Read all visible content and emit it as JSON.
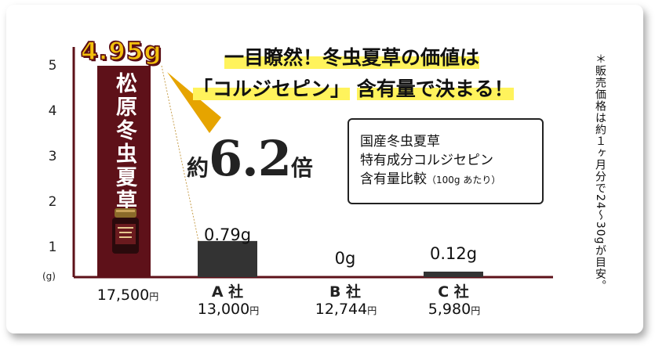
{
  "chart_data": {
    "type": "bar",
    "categories": [
      "松原冬虫夏草",
      "A 社",
      "B 社",
      "C 社"
    ],
    "values": [
      4.95,
      0.79,
      0,
      0.12
    ],
    "value_labels": [
      "4.95g",
      "0.79g",
      "0g",
      "0.12g"
    ],
    "prices": [
      "17,500",
      "13,000",
      "12,744",
      "5,980"
    ],
    "price_unit": "円",
    "yunit": "(g)",
    "yticks": [
      "1",
      "2",
      "3",
      "4",
      "5"
    ],
    "ylim": [
      0,
      5
    ],
    "colors": {
      "highlight": "#5e1119",
      "other": "#333333",
      "axis": "#5e1119",
      "hero_text": "#f3c10c",
      "marker": "#fff35c"
    }
  },
  "brand_label": "松原冬虫夏草",
  "headline": {
    "line1": "一目瞭然！冬虫夏草の価値は",
    "line2_quote": "「コルジセピン」",
    "line2_rest": "含有量で決まる！"
  },
  "ratio": {
    "prefix": "約",
    "number": "6.2",
    "suffix": "倍"
  },
  "infobox": {
    "line1": "国産冬虫夏草",
    "line2": "特有成分コルジセピン",
    "line3_main": "含有量比較",
    "line3_small": "（100g あたり）"
  },
  "note": "＊販売価格は約１ヶ月分で24〜30gが目安。",
  "jar_label": "松原冬虫夏草"
}
